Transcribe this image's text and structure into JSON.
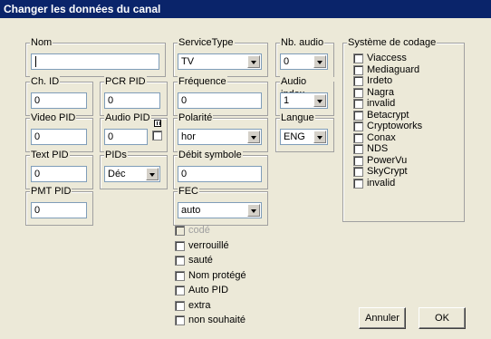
{
  "window": {
    "title": "Changer les données du canal"
  },
  "groups": {
    "nom": "Nom",
    "service_type": "ServiceType",
    "nb_audio": "Nb. audio",
    "systeme": "Système de codage",
    "ch_id": "Ch. ID",
    "pcr_pid": "PCR PID",
    "frequence": "Fréquence",
    "audio_index": "Audio index",
    "video_pid": "Video PID",
    "audio_pid": "Audio PID",
    "polarite": "Polarité",
    "langue": "Langue",
    "text_pid": "Text PID",
    "pids": "PIDs",
    "debit": "Débit symbole",
    "pmt_pid": "PMT PID",
    "fec": "FEC"
  },
  "values": {
    "nom": "",
    "service_type": "TV",
    "nb_audio": "0",
    "ch_id": "0",
    "pcr_pid": "0",
    "frequence": "0",
    "audio_index": "1",
    "video_pid": "0",
    "audio_pid": "0",
    "polarite": "hor",
    "langue": "ENG",
    "text_pid": "0",
    "pids": "Déc",
    "debit": "0",
    "pmt_pid": "0",
    "fec": "auto"
  },
  "codage": [
    "Viaccess",
    "Mediaguard",
    "Irdeto",
    "Nagra",
    "invalid",
    "Betacrypt",
    "Cryptoworks",
    "Conax",
    "NDS",
    "PowerVu",
    "SkyCrypt",
    "invalid"
  ],
  "flags": [
    "codé",
    "verrouillé",
    "sauté",
    "Nom protégé",
    "Auto PID",
    "extra",
    "non souhaité"
  ],
  "buttons": {
    "annuler": "Annuler",
    "ok": "OK"
  }
}
